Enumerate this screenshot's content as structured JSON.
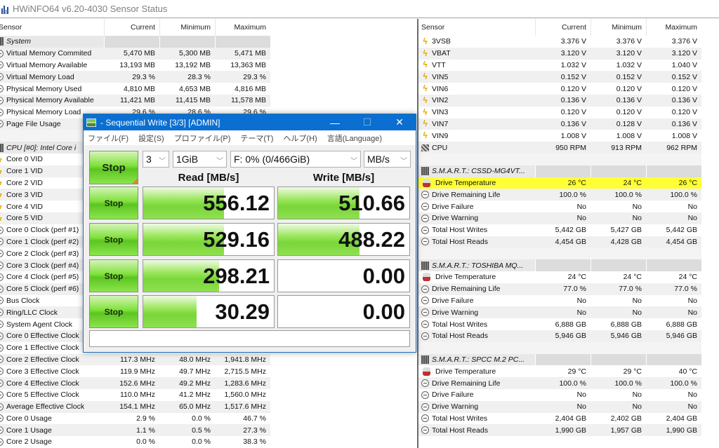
{
  "window_title": "HWiNFO64 v6.20-4030 Sensor Status",
  "columns": {
    "sensor": "Sensor",
    "current": "Current",
    "minimum": "Minimum",
    "maximum": "Maximum"
  },
  "left_panel": {
    "rows": [
      {
        "type": "group",
        "icon": "chip-icon",
        "label": "System"
      },
      {
        "icon": "clock-icon",
        "label": "Virtual Memory Commited",
        "current": "5,470 MB",
        "minimum": "5,300 MB",
        "maximum": "5,471 MB"
      },
      {
        "icon": "clock-icon",
        "label": "Virtual Memory Available",
        "current": "13,193 MB",
        "minimum": "13,192 MB",
        "maximum": "13,363 MB"
      },
      {
        "icon": "clock-icon",
        "label": "Virtual Memory Load",
        "current": "29.3 %",
        "minimum": "28.3 %",
        "maximum": "29.3 %"
      },
      {
        "icon": "clock-icon",
        "label": "Physical Memory Used",
        "current": "4,810 MB",
        "minimum": "4,653 MB",
        "maximum": "4,816 MB"
      },
      {
        "icon": "clock-icon",
        "label": "Physical Memory Available",
        "current": "11,421 MB",
        "minimum": "11,415 MB",
        "maximum": "11,578 MB"
      },
      {
        "icon": "clock-icon",
        "label": "Physical Memory Load",
        "current": "29.6 %",
        "minimum": "28.6 %",
        "maximum": "29.6 %"
      },
      {
        "icon": "clock-icon",
        "label": "Page File Usage",
        "current": "",
        "minimum": "",
        "maximum": ""
      },
      {
        "type": "blank"
      },
      {
        "type": "group",
        "icon": "chip-icon",
        "label": "CPU [#0]: Intel Core i"
      },
      {
        "icon": "bolt-icon",
        "label": "Core 0 VID",
        "current": "",
        "minimum": "",
        "maximum": ""
      },
      {
        "icon": "bolt-icon",
        "label": "Core 1 VID",
        "current": "",
        "minimum": "",
        "maximum": ""
      },
      {
        "icon": "bolt-icon",
        "label": "Core 2 VID",
        "current": "",
        "minimum": "",
        "maximum": ""
      },
      {
        "icon": "bolt-icon",
        "label": "Core 3 VID",
        "current": "",
        "minimum": "",
        "maximum": ""
      },
      {
        "icon": "bolt-icon",
        "label": "Core 4 VID",
        "current": "",
        "minimum": "",
        "maximum": ""
      },
      {
        "icon": "bolt-icon",
        "label": "Core 5 VID",
        "current": "",
        "minimum": "",
        "maximum": ""
      },
      {
        "icon": "clock-icon",
        "label": "Core 0 Clock (perf #1)",
        "current": "",
        "minimum": "",
        "maximum": ""
      },
      {
        "icon": "clock-icon",
        "label": "Core 1 Clock (perf #2)",
        "current": "",
        "minimum": "",
        "maximum": ""
      },
      {
        "icon": "clock-icon",
        "label": "Core 2 Clock (perf #3)",
        "current": "",
        "minimum": "",
        "maximum": ""
      },
      {
        "icon": "clock-icon",
        "label": "Core 3 Clock (perf #4)",
        "current": "",
        "minimum": "",
        "maximum": ""
      },
      {
        "icon": "clock-icon",
        "label": "Core 4 Clock (perf #5)",
        "current": "",
        "minimum": "",
        "maximum": ""
      },
      {
        "icon": "clock-icon",
        "label": "Core 5 Clock (perf #6)",
        "current": "",
        "minimum": "",
        "maximum": ""
      },
      {
        "icon": "clock-icon",
        "label": "Bus Clock",
        "current": "",
        "minimum": "",
        "maximum": ""
      },
      {
        "icon": "clock-icon",
        "label": "Ring/LLC Clock",
        "current": "",
        "minimum": "",
        "maximum": ""
      },
      {
        "icon": "clock-icon",
        "label": "System Agent Clock",
        "current": "",
        "minimum": "",
        "maximum": ""
      },
      {
        "icon": "clock-icon",
        "label": "Core 0 Effective Clock",
        "current": "",
        "minimum": "",
        "maximum": ""
      },
      {
        "icon": "clock-icon",
        "label": "Core 1 Effective Clock",
        "current": "",
        "minimum": "",
        "maximum": ""
      },
      {
        "icon": "clock-icon",
        "label": "Core 2 Effective Clock",
        "current": "117.3 MHz",
        "minimum": "48.0 MHz",
        "maximum": "1,941.8 MHz"
      },
      {
        "icon": "clock-icon",
        "label": "Core 3 Effective Clock",
        "current": "119.9 MHz",
        "minimum": "49.7 MHz",
        "maximum": "2,715.5 MHz"
      },
      {
        "icon": "clock-icon",
        "label": "Core 4 Effective Clock",
        "current": "152.6 MHz",
        "minimum": "49.2 MHz",
        "maximum": "1,283.6 MHz"
      },
      {
        "icon": "clock-icon",
        "label": "Core 5 Effective Clock",
        "current": "110.0 MHz",
        "minimum": "41.2 MHz",
        "maximum": "1,560.0 MHz"
      },
      {
        "icon": "clock-icon",
        "label": "Average Effective Clock",
        "current": "154.1 MHz",
        "minimum": "65.0 MHz",
        "maximum": "1,517.6 MHz"
      },
      {
        "icon": "clock-icon",
        "label": "Core 0 Usage",
        "current": "2.9 %",
        "minimum": "0.0 %",
        "maximum": "46.7 %"
      },
      {
        "icon": "clock-icon",
        "label": "Core 1 Usage",
        "current": "1.1 %",
        "minimum": "0.5 %",
        "maximum": "27.3 %"
      },
      {
        "icon": "clock-icon",
        "label": "Core 2 Usage",
        "current": "0.0 %",
        "minimum": "0.0 %",
        "maximum": "38.3 %"
      }
    ]
  },
  "right_panel": {
    "rows": [
      {
        "icon": "bolt-icon",
        "label": "3VSB",
        "current": "3.376 V",
        "minimum": "3.376 V",
        "maximum": "3.376 V"
      },
      {
        "icon": "bolt-icon",
        "label": "VBAT",
        "current": "3.120 V",
        "minimum": "3.120 V",
        "maximum": "3.120 V"
      },
      {
        "icon": "bolt-icon",
        "label": "VTT",
        "current": "1.032 V",
        "minimum": "1.032 V",
        "maximum": "1.040 V"
      },
      {
        "icon": "bolt-icon",
        "label": "VIN5",
        "current": "0.152 V",
        "minimum": "0.152 V",
        "maximum": "0.152 V"
      },
      {
        "icon": "bolt-icon",
        "label": "VIN6",
        "current": "0.120 V",
        "minimum": "0.120 V",
        "maximum": "0.120 V"
      },
      {
        "icon": "bolt-icon",
        "label": "VIN2",
        "current": "0.136 V",
        "minimum": "0.136 V",
        "maximum": "0.136 V"
      },
      {
        "icon": "bolt-icon",
        "label": "VIN3",
        "current": "0.120 V",
        "minimum": "0.120 V",
        "maximum": "0.120 V"
      },
      {
        "icon": "bolt-icon",
        "label": "VIN7",
        "current": "0.136 V",
        "minimum": "0.128 V",
        "maximum": "0.136 V"
      },
      {
        "icon": "bolt-icon",
        "label": "VIN9",
        "current": "1.008 V",
        "minimum": "1.008 V",
        "maximum": "1.008 V"
      },
      {
        "icon": "fan-icon",
        "label": "CPU",
        "current": "950 RPM",
        "minimum": "913 RPM",
        "maximum": "962 RPM"
      },
      {
        "type": "blank"
      },
      {
        "type": "group",
        "icon": "chip-icon",
        "label": "S.M.A.R.T.: CSSD-MG4VT..."
      },
      {
        "icon": "thermometer-icon",
        "label": "Drive Temperature",
        "current": "26 °C",
        "minimum": "24 °C",
        "maximum": "26 °C",
        "highlight": true
      },
      {
        "icon": "clock-icon",
        "label": "Drive Remaining Life",
        "current": "100.0 %",
        "minimum": "100.0 %",
        "maximum": "100.0 %"
      },
      {
        "icon": "clock-icon",
        "label": "Drive Failure",
        "current": "No",
        "minimum": "No",
        "maximum": "No"
      },
      {
        "icon": "clock-icon",
        "label": "Drive Warning",
        "current": "No",
        "minimum": "No",
        "maximum": "No"
      },
      {
        "icon": "clock-icon",
        "label": "Total Host Writes",
        "current": "5,442 GB",
        "minimum": "5,427 GB",
        "maximum": "5,442 GB"
      },
      {
        "icon": "clock-icon",
        "label": "Total Host Reads",
        "current": "4,454 GB",
        "minimum": "4,428 GB",
        "maximum": "4,454 GB"
      },
      {
        "type": "blank"
      },
      {
        "type": "group",
        "icon": "chip-icon",
        "label": "S.M.A.R.T.: TOSHIBA MQ..."
      },
      {
        "icon": "thermometer-icon",
        "label": "Drive Temperature",
        "current": "24 °C",
        "minimum": "24 °C",
        "maximum": "24 °C"
      },
      {
        "icon": "clock-icon",
        "label": "Drive Remaining Life",
        "current": "77.0 %",
        "minimum": "77.0 %",
        "maximum": "77.0 %"
      },
      {
        "icon": "clock-icon",
        "label": "Drive Failure",
        "current": "No",
        "minimum": "No",
        "maximum": "No"
      },
      {
        "icon": "clock-icon",
        "label": "Drive Warning",
        "current": "No",
        "minimum": "No",
        "maximum": "No"
      },
      {
        "icon": "clock-icon",
        "label": "Total Host Writes",
        "current": "6,888 GB",
        "minimum": "6,888 GB",
        "maximum": "6,888 GB"
      },
      {
        "icon": "clock-icon",
        "label": "Total Host Reads",
        "current": "5,946 GB",
        "minimum": "5,946 GB",
        "maximum": "5,946 GB"
      },
      {
        "type": "blank"
      },
      {
        "type": "group",
        "icon": "chip-icon",
        "label": "S.M.A.R.T.: SPCC M.2 PC..."
      },
      {
        "icon": "thermometer-icon",
        "label": "Drive Temperature",
        "current": "29 °C",
        "minimum": "29 °C",
        "maximum": "40 °C"
      },
      {
        "icon": "clock-icon",
        "label": "Drive Remaining Life",
        "current": "100.0 %",
        "minimum": "100.0 %",
        "maximum": "100.0 %"
      },
      {
        "icon": "clock-icon",
        "label": "Drive Failure",
        "current": "No",
        "minimum": "No",
        "maximum": "No"
      },
      {
        "icon": "clock-icon",
        "label": "Drive Warning",
        "current": "No",
        "minimum": "No",
        "maximum": "No"
      },
      {
        "icon": "clock-icon",
        "label": "Total Host Writes",
        "current": "2,404 GB",
        "minimum": "2,402 GB",
        "maximum": "2,404 GB"
      },
      {
        "icon": "clock-icon",
        "label": "Total Host Reads",
        "current": "1,990 GB",
        "minimum": "1,957 GB",
        "maximum": "1,990 GB"
      }
    ]
  },
  "cdm": {
    "title": "- Sequential Write [3/3] [ADMIN]",
    "window_buttons": {
      "minimize": "—",
      "maximize": "☐",
      "close": "✕"
    },
    "menu": [
      "ファイル(F)",
      "設定(S)",
      "プロファイル(P)",
      "テーマ(T)",
      "ヘルプ(H)",
      "言語(Language)"
    ],
    "stop_label": "Stop",
    "count": "3",
    "size": "1GiB",
    "drive": "F: 0% (0/466GiB)",
    "unit": "MB/s",
    "read_header": "Read [MB/s]",
    "write_header": "Write [MB/s]",
    "results": [
      {
        "button": "Stop",
        "read": "556.12",
        "write": "510.66",
        "read_fill": 0.62,
        "write_fill": 0.62
      },
      {
        "button": "Stop",
        "read": "529.16",
        "write": "488.22",
        "read_fill": 0.62,
        "write_fill": 0.62
      },
      {
        "button": "Stop",
        "read": "298.21",
        "write": "0.00",
        "read_fill": 0.58,
        "write_fill": 0
      },
      {
        "button": "Stop",
        "read": "30.29",
        "write": "0.00",
        "read_fill": 0.41,
        "write_fill": 0
      }
    ],
    "status": ""
  }
}
